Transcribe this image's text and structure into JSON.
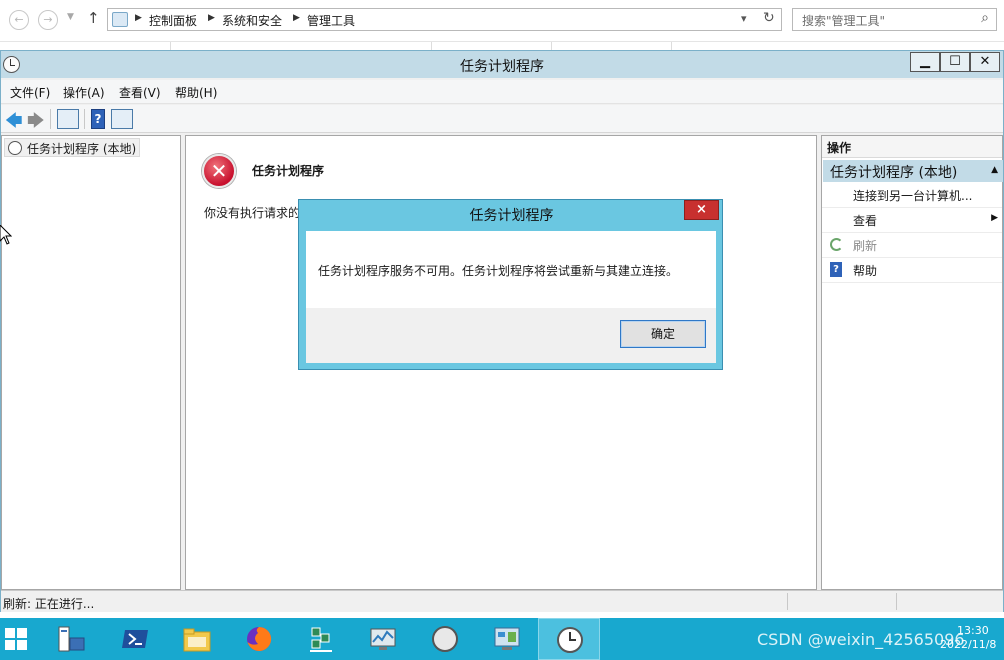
{
  "explorer": {
    "breadcrumb": [
      "控制面板",
      "系统和安全",
      "管理工具"
    ],
    "search_placeholder": "搜索\"管理工具\""
  },
  "window": {
    "title": "任务计划程序"
  },
  "menu": [
    "文件(F)",
    "操作(A)",
    "查看(V)",
    "帮助(H)"
  ],
  "tree": {
    "root_label": "任务计划程序 (本地)"
  },
  "main": {
    "error_title": "任务计划程序",
    "error_message": "你没有执行请求的"
  },
  "actions": {
    "header": "操作",
    "group": "任务计划程序 (本地)",
    "items": [
      {
        "label": "连接到另一台计算机...",
        "enabled": true
      },
      {
        "label": "查看",
        "enabled": true,
        "submenu": true
      },
      {
        "label": "刷新",
        "enabled": false
      },
      {
        "label": "帮助",
        "enabled": true
      }
    ]
  },
  "status": {
    "text": "刷新:  正在进行..."
  },
  "dialog": {
    "title": "任务计划程序",
    "close": "×",
    "message": "任务计划程序服务不可用。任务计划程序将尝试重新与其建立连接。",
    "ok_label": "确定"
  },
  "taskbar": {
    "watermark": "CSDN @weixin_42565096",
    "time": "13:30",
    "date": "2022/11/8"
  },
  "colors": {
    "title_bar": "#c2dbe7",
    "dialog_frame": "#6ac7e1",
    "taskbar": "#18a8cf",
    "dialog_close": "#c8302f",
    "error_red": "#c8102e"
  }
}
